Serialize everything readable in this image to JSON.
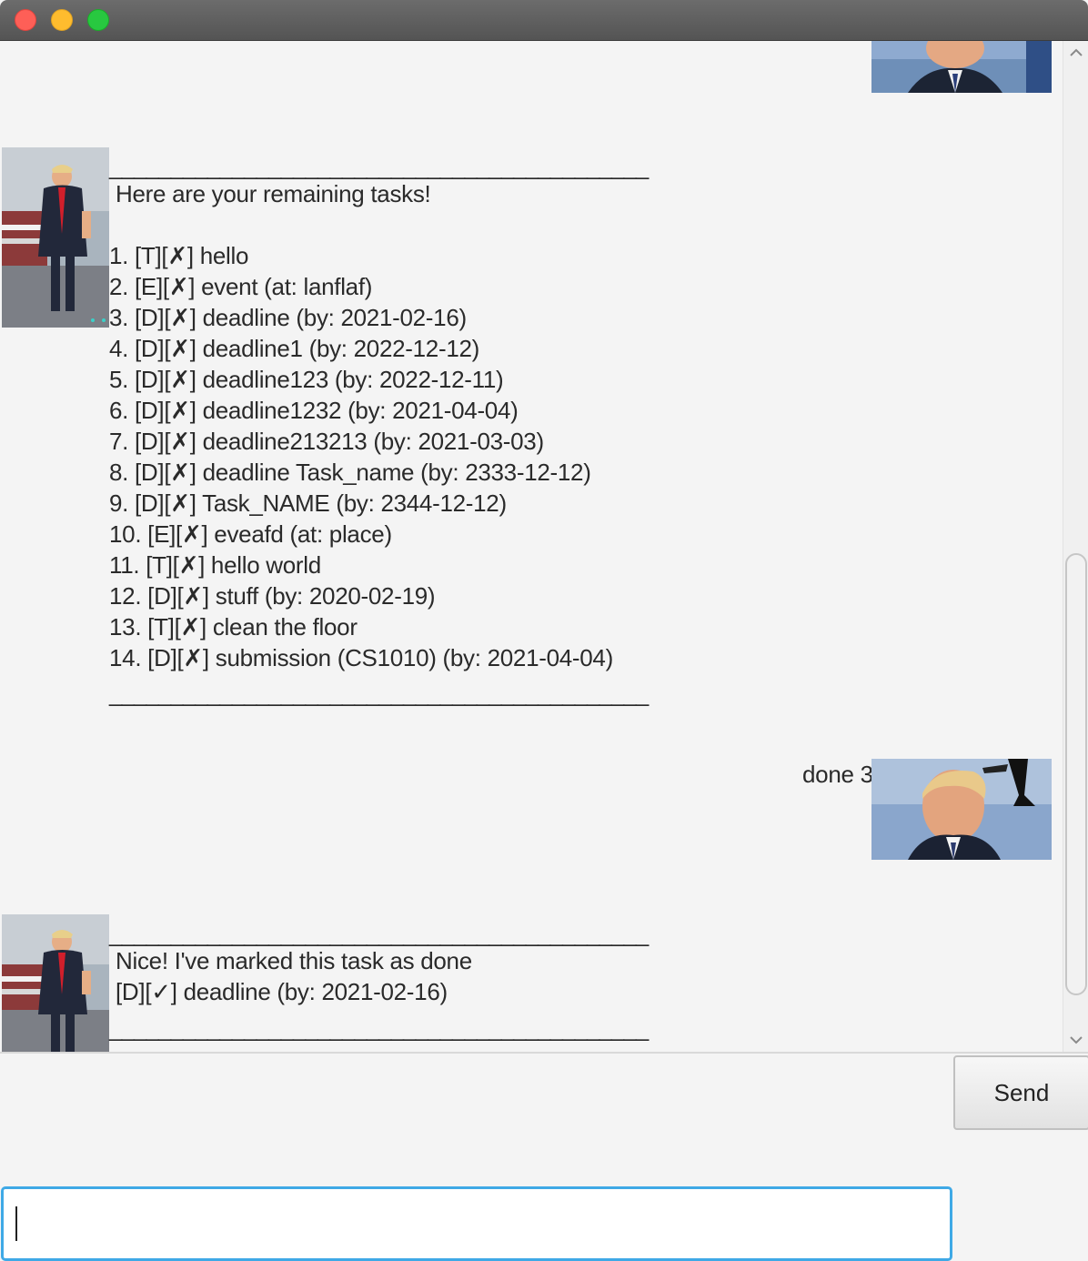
{
  "window": {
    "controls": [
      "close",
      "minimize",
      "zoom"
    ]
  },
  "chat": {
    "messages": [
      {
        "sender": "bot",
        "divider_top": "____________________________________________",
        "header": "Here are your remaining tasks!",
        "tasks": [
          "1. [T][✗] hello",
          "2. [E][✗] event (at: lanflaf)",
          "3. [D][✗] deadline (by: 2021-02-16)",
          "4. [D][✗] deadline1 (by: 2022-12-12)",
          "5. [D][✗] deadline123 (by: 2022-12-11)",
          "6. [D][✗] deadline1232 (by: 2021-04-04)",
          "7. [D][✗] deadline213213 (by: 2021-03-03)",
          "8. [D][✗] deadline Task_name (by: 2333-12-12)",
          "9. [D][✗] Task_NAME (by: 2344-12-12)",
          "10. [E][✗] eveafd (at: place)",
          "11. [T][✗] hello world",
          "12. [D][✗] stuff (by: 2020-02-19)",
          "13. [T][✗] clean the floor",
          "14. [D][✗] submission (CS1010) (by: 2021-04-04)"
        ],
        "divider_bottom": "____________________________________________"
      },
      {
        "sender": "user",
        "text": "done 3"
      },
      {
        "sender": "bot",
        "divider_top": "____________________________________________",
        "line1": "Nice! I've marked this task as done",
        "line2": "[D][✓] deadline (by: 2021-02-16)",
        "divider_bottom": "____________________________________________"
      }
    ]
  },
  "input": {
    "value": "",
    "placeholder": ""
  },
  "send_button": {
    "label": "Send"
  },
  "colors": {
    "background": "#f4f4f4",
    "input_focus_border": "#3fa9e6",
    "title_bar": "#5e5e5e"
  }
}
